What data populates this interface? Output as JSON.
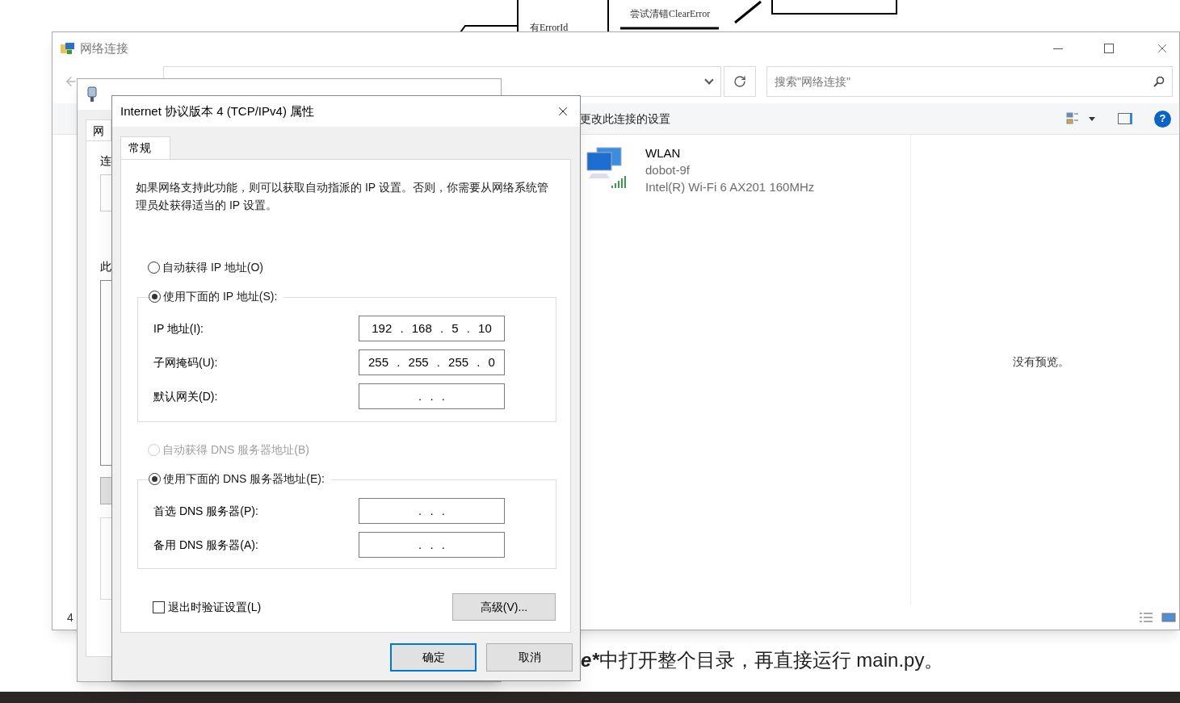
{
  "diagram": {
    "node_label": "有ErrorId",
    "edge_label": "尝试清错ClearError"
  },
  "explorer": {
    "title": "网络连接",
    "search": {
      "placeholder": "搜索\"网络连接\""
    },
    "command": "更改此连接的设置",
    "connection": {
      "name": "WLAN",
      "network": "dobot-9f",
      "adapter": "Intel(R) Wi-Fi 6 AX201 160MHz"
    },
    "preview_text": "没有预览。",
    "status_count": "4",
    "help_label": "?"
  },
  "ethernet_dialog": {
    "tab": "网",
    "label_1": "连",
    "label_2": "此"
  },
  "ipv4_dialog": {
    "title": "Internet 协议版本 4 (TCP/IPv4) 属性",
    "tabs": [
      {
        "label": "常规",
        "selected": true
      }
    ],
    "description": "如果网络支持此功能，则可以获取自动指派的 IP 设置。否则，你需要从网络系统管理员处获得适当的 IP 设置。",
    "ip_mode": [
      {
        "label": "自动获得 IP 地址(O)",
        "selected": false,
        "disabled": false
      },
      {
        "label": "使用下面的 IP 地址(S):",
        "selected": true,
        "disabled": false
      }
    ],
    "ip_fields": [
      {
        "label": "IP 地址(I):",
        "value": "192 . 168 . 5 . 10"
      },
      {
        "label": "子网掩码(U):",
        "value": "255 . 255 . 255 . 0"
      },
      {
        "label": "默认网关(D):",
        "value": ". . ."
      }
    ],
    "dns_mode": [
      {
        "label": "自动获得 DNS 服务器地址(B)",
        "selected": false,
        "disabled": true
      },
      {
        "label": "使用下面的 DNS 服务器地址(E):",
        "selected": true,
        "disabled": false
      }
    ],
    "dns_fields": [
      {
        "label": "首选 DNS 服务器(P):",
        "value": ". . ."
      },
      {
        "label": "备用 DNS 服务器(A):",
        "value": ". . ."
      }
    ],
    "validate": {
      "label": "退出时验证设置(L)",
      "checked": false
    },
    "advanced_button": "高级(V)...",
    "buttons": [
      {
        "label": "确定",
        "default": true
      },
      {
        "label": "取消",
        "default": false
      }
    ]
  },
  "background_text": {
    "lead": "e*",
    "rest": "中打开整个目录，再直接运行 main.py。"
  }
}
